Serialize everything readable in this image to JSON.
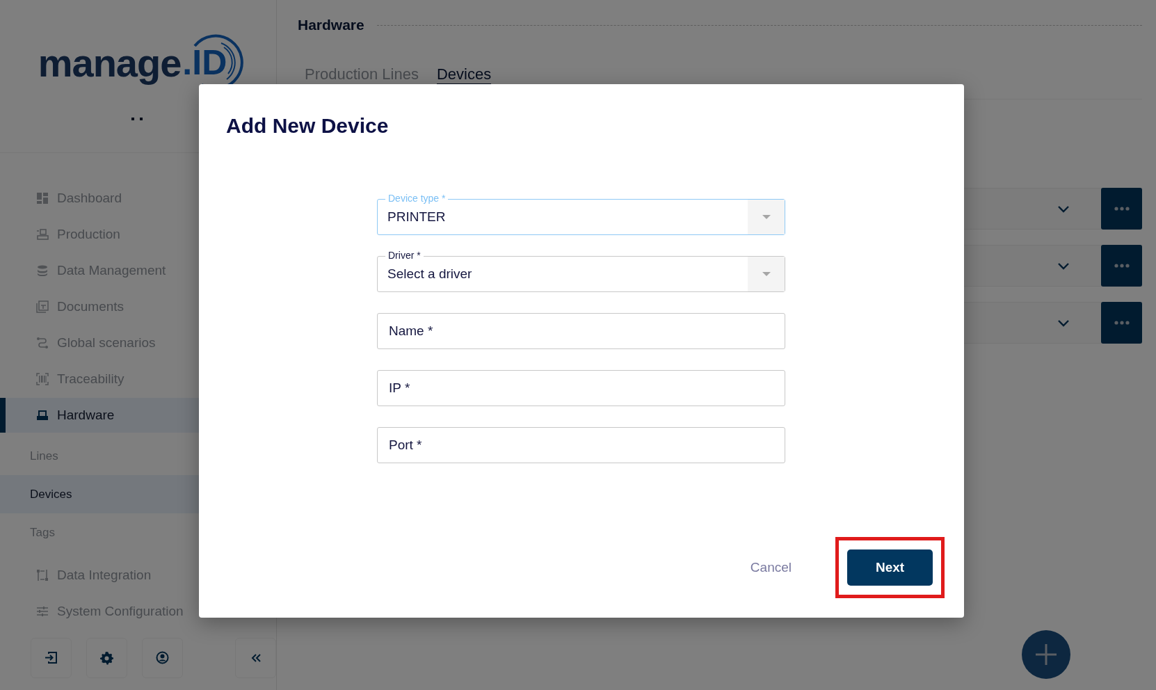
{
  "sidebar": {
    "logo": {
      "wordmark": "manage",
      "suffix": ".ID"
    },
    "nav": [
      {
        "label": "Dashboard",
        "selected": false
      },
      {
        "label": "Production",
        "selected": false
      },
      {
        "label": "Data Management",
        "selected": false
      },
      {
        "label": "Documents",
        "selected": false
      },
      {
        "label": "Global scenarios",
        "selected": false
      },
      {
        "label": "Traceability",
        "selected": false
      },
      {
        "label": "Hardware",
        "selected": true,
        "children": [
          {
            "label": "Lines",
            "selected": false
          },
          {
            "label": "Devices",
            "selected": true
          },
          {
            "label": "Tags",
            "selected": false
          }
        ]
      },
      {
        "label": "Data Integration",
        "selected": false
      },
      {
        "label": "System Configuration",
        "selected": false
      }
    ]
  },
  "page": {
    "title": "Hardware",
    "tabs": [
      {
        "label": "Production Lines",
        "selected": false
      },
      {
        "label": "Devices",
        "selected": true
      }
    ],
    "device_rows": [
      {
        "expanded": false
      },
      {
        "expanded": false
      },
      {
        "expanded": false
      }
    ]
  },
  "dialog": {
    "title": "Add New Device",
    "fields": [
      {
        "kind": "select",
        "label": "Device type *",
        "value": "PRINTER",
        "focused": true
      },
      {
        "kind": "select",
        "label": "Driver *",
        "placeholder": "Select a driver",
        "focused": false
      },
      {
        "kind": "text",
        "placeholder": "Name *"
      },
      {
        "kind": "text",
        "placeholder": "IP *"
      },
      {
        "kind": "text",
        "placeholder": "Port *"
      }
    ],
    "buttons": [
      {
        "kind": "text",
        "label": "Cancel",
        "highlighted": false
      },
      {
        "kind": "primary",
        "label": "Next",
        "highlighted": true
      }
    ]
  }
}
